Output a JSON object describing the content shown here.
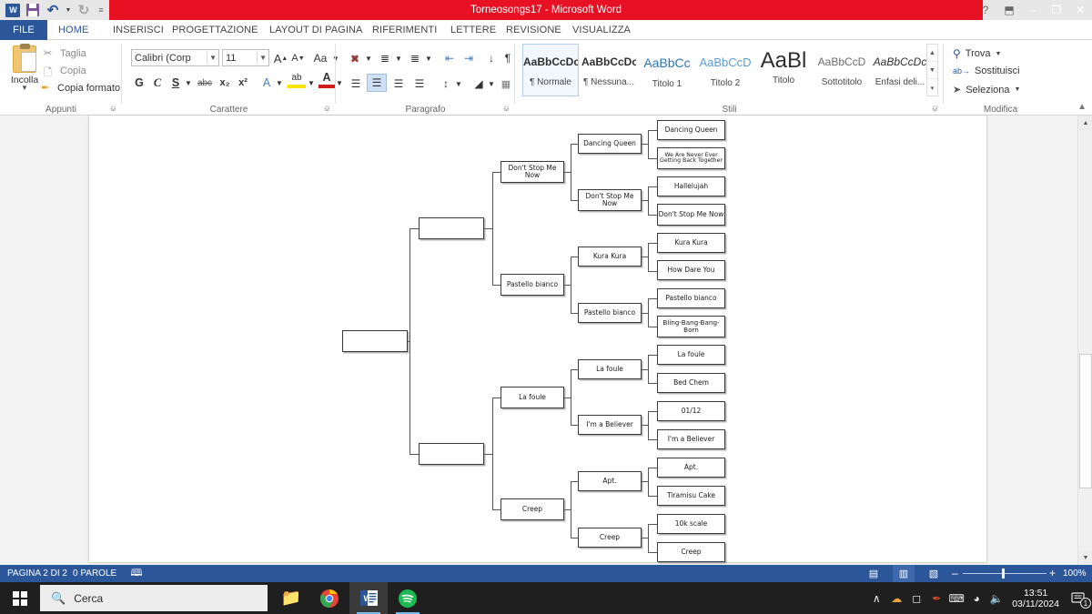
{
  "window": {
    "title": "Torneosongs17 -  Microsoft Word",
    "quick_access": [
      {
        "name": "word-logo",
        "label": "W"
      },
      {
        "name": "save-icon",
        "label": ""
      },
      {
        "name": "undo-icon",
        "label": "↶"
      },
      {
        "name": "redo-icon",
        "label": "↻"
      },
      {
        "name": "customize-qat-icon",
        "label": "≡"
      }
    ],
    "controls": {
      "help": "?",
      "ribbon_display": "⬒",
      "minimize": "–",
      "restore": "❐",
      "close": "✕"
    }
  },
  "ribbon": {
    "tabs": [
      {
        "label": "FILE",
        "state": "file"
      },
      {
        "label": "HOME",
        "state": "active"
      },
      {
        "label": "INSERISCI",
        "state": "normal"
      },
      {
        "label": "PROGETTAZIONE",
        "state": "normal"
      },
      {
        "label": "LAYOUT DI PAGINA",
        "state": "normal"
      },
      {
        "label": "RIFERIMENTI",
        "state": "normal"
      },
      {
        "label": "LETTERE",
        "state": "normal"
      },
      {
        "label": "REVISIONE",
        "state": "normal"
      },
      {
        "label": "VISUALIZZA",
        "state": "normal"
      }
    ],
    "groups": {
      "clipboard": {
        "label": "Appunti",
        "paste": "Incolla",
        "cut": "Taglia",
        "copy": "Copia",
        "format_painter": "Copia formato"
      },
      "font": {
        "label": "Carattere",
        "font_name": "Calibri (Corp",
        "font_size": "11",
        "grow": "A",
        "shrink": "A",
        "change_case": "Aa",
        "clear_formatting": "✐",
        "bold": "G",
        "italic": "C",
        "underline": "S",
        "strikethrough": "abc",
        "subscript": "x₂",
        "superscript": "x²",
        "text_effects": "A",
        "highlight": "ab",
        "font_color": "A"
      },
      "paragraph": {
        "label": "Paragrafo",
        "bullets": "bullets-icon",
        "numbering": "numbering-icon",
        "multilevel": "multilevel-list-icon",
        "decrease_indent": "decrease-indent-icon",
        "increase_indent": "increase-indent-icon",
        "sort": "sort-icon",
        "show_marks": "¶",
        "align_left": "align-left-icon",
        "align_center": "align-center-icon",
        "align_right": "align-right-icon",
        "justify": "justify-icon",
        "line_spacing": "line-spacing-icon",
        "shading": "shading-icon",
        "borders": "borders-icon"
      },
      "styles": {
        "label": "Stili",
        "items": [
          {
            "preview": "AaBbCcDc",
            "name": "¶ Normale",
            "style": "normal-bold"
          },
          {
            "preview": "AaBbCcDc",
            "name": "¶ Nessuna...",
            "style": "normal-bold"
          },
          {
            "preview": "AaBbCc",
            "name": "Titolo 1",
            "style": "blue"
          },
          {
            "preview": "AaBbCcD",
            "name": "Titolo 2",
            "style": "blue-light"
          },
          {
            "preview": "AaBl",
            "name": "Titolo",
            "style": "big"
          },
          {
            "preview": "AaBbCcD",
            "name": "Sottotitolo",
            "style": "grey"
          },
          {
            "preview": "AaBbCcDc",
            "name": "Enfasi deli...",
            "style": "italic"
          }
        ]
      },
      "editing": {
        "label": "Modifica",
        "find": "Trova",
        "replace": "Sostituisci",
        "select": "Seleziona"
      }
    }
  },
  "bracket": {
    "round_final": [
      {
        "label": ""
      }
    ],
    "round_semi": [
      {
        "label": ""
      },
      {
        "label": ""
      }
    ],
    "round_quarter": [
      {
        "label": "Don't Stop Me Now"
      },
      {
        "label": "Pastello bianco"
      },
      {
        "label": "La foule"
      },
      {
        "label": "Creep"
      }
    ],
    "round_eight": [
      {
        "label": "Dancing Queen"
      },
      {
        "label": "Don't Stop Me Now"
      },
      {
        "label": "Kura Kura"
      },
      {
        "label": "Pastello bianco"
      },
      {
        "label": "La foule"
      },
      {
        "label": "I'm a Believer"
      },
      {
        "label": "Apt."
      },
      {
        "label": "Creep"
      }
    ],
    "round_sixteen": [
      {
        "label": "Dancing Queen"
      },
      {
        "label": "We Are Never Ever Getting Back Together"
      },
      {
        "label": "Hallelujah"
      },
      {
        "label": "Don't Stop Me Now"
      },
      {
        "label": "Kura Kura"
      },
      {
        "label": "How Dare You"
      },
      {
        "label": "Pastello bianco"
      },
      {
        "label": "Bling-Bang-Bang-Born"
      },
      {
        "label": "La foule"
      },
      {
        "label": "Bed Chem"
      },
      {
        "label": "01/12"
      },
      {
        "label": "I'm a Believer"
      },
      {
        "label": "Apt."
      },
      {
        "label": "Tiramisu Cake"
      },
      {
        "label": "10k scale"
      },
      {
        "label": "Creep"
      }
    ]
  },
  "statusbar": {
    "page": "PAGINA 2 DI 2",
    "words": "0 PAROLE",
    "proofing": "proofing-icon",
    "views": [
      {
        "name": "read-mode-icon",
        "glyph": "▤",
        "active": false
      },
      {
        "name": "print-layout-icon",
        "glyph": "▥",
        "active": true
      },
      {
        "name": "web-layout-icon",
        "glyph": "▧",
        "active": false
      }
    ],
    "zoom_out": "–",
    "zoom_in": "+",
    "zoom_level": "100%"
  },
  "taskbar": {
    "start": "start-button",
    "search_placeholder": "Cerca",
    "apps": [
      {
        "name": "file-explorer-icon",
        "open": false
      },
      {
        "name": "chrome-icon",
        "open": true
      },
      {
        "name": "word-icon",
        "open": true
      },
      {
        "name": "spotify-icon",
        "open": true
      }
    ],
    "tray": {
      "show_hidden": "∧",
      "icons": [
        "onedrive-icon",
        "camera-icon",
        "paint-icon",
        "keyboard-icon"
      ],
      "network": "wifi-icon",
      "volume": "volume-muted-icon",
      "time": "13:51",
      "date": "03/11/2024",
      "notifications": "1"
    }
  },
  "colors": {
    "word_red": "#e81123",
    "word_blue": "#2b579a",
    "status_blue": "#2b579a",
    "taskbar": "#1f1f1f"
  }
}
